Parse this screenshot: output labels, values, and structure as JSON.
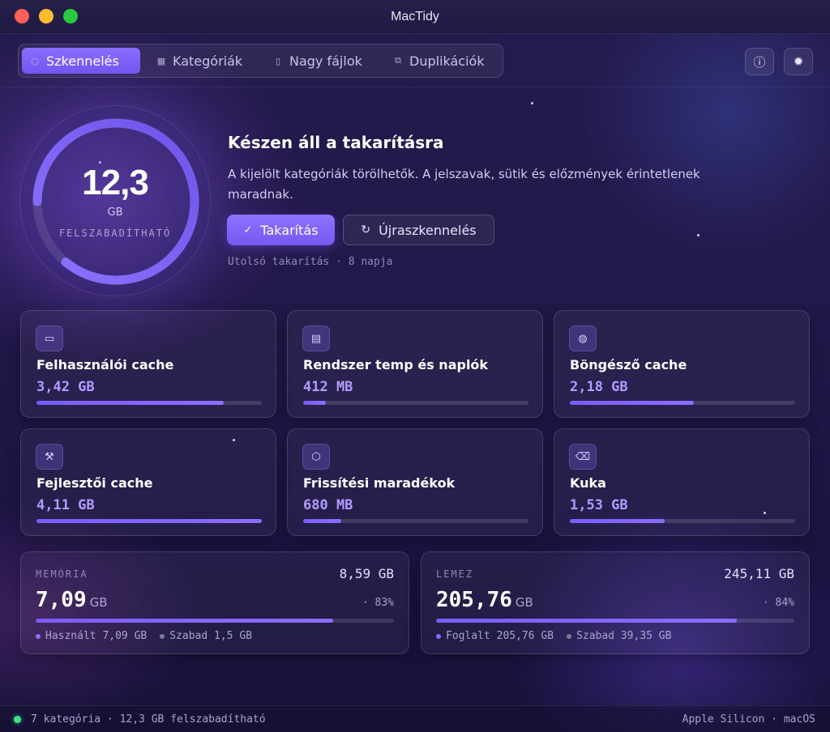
{
  "window": {
    "title": "MacTidy"
  },
  "tabs": [
    {
      "label": "Szkennelés",
      "icon": "spinner-icon",
      "active": true
    },
    {
      "label": "Kategóriák",
      "icon": "grid-icon",
      "active": false
    },
    {
      "label": "Nagy fájlok",
      "icon": "file-icon",
      "active": false
    },
    {
      "label": "Duplikációk",
      "icon": "copy-icon",
      "active": false
    }
  ],
  "toolbar_icons": [
    "info-icon",
    "gear-icon"
  ],
  "gauge": {
    "value": "12,3",
    "unit": "GB",
    "label": "FELSZABADÍTHATÓ",
    "progress": 0.86
  },
  "hero": {
    "title": "Készen áll a takarításra",
    "description": "A kijelölt kategóriák törölhetők. A jelszavak, sütik és előzmények érintetlenek maradnak.",
    "primary_button": "Takarítás",
    "secondary_button": "Újraszkennelés",
    "last_clean": "Utolsó takarítás · 8 napja"
  },
  "categories": [
    {
      "name": "Felhasználói cache",
      "size": "3,42 GB",
      "fill": 0.83,
      "icon": "drive-icon"
    },
    {
      "name": "Rendszer temp és naplók",
      "size": "412 MB",
      "fill": 0.1,
      "icon": "document-icon"
    },
    {
      "name": "Böngésző cache",
      "size": "2,18 GB",
      "fill": 0.55,
      "icon": "globe-icon"
    },
    {
      "name": "Fejlesztői cache",
      "size": "4,11 GB",
      "fill": 1.0,
      "icon": "wrench-icon"
    },
    {
      "name": "Frissítési maradékok",
      "size": "680 MB",
      "fill": 0.17,
      "icon": "package-icon"
    },
    {
      "name": "Kuka",
      "size": "1,53 GB",
      "fill": 0.42,
      "icon": "trash-icon"
    }
  ],
  "memory": {
    "label": "MEMÓRIA",
    "total": "8,59 GB",
    "value": "7,09",
    "unit": "GB",
    "percent": "83%",
    "fill": 0.83,
    "used": "Használt 7,09 GB",
    "free": "Szabad 1,5 GB"
  },
  "disk": {
    "label": "LEMEZ",
    "total": "245,11 GB",
    "value": "205,76",
    "unit": "GB",
    "percent": "84%",
    "fill": 0.84,
    "used": "Foglalt 205,76 GB",
    "free": "Szabad 39,35 GB"
  },
  "status": {
    "left": "7 kategória · 12,3 GB felszabadítható",
    "right": "Apple Silicon · macOS"
  },
  "colors": {
    "accent": "#7b5cff",
    "success": "#3ee08f"
  }
}
